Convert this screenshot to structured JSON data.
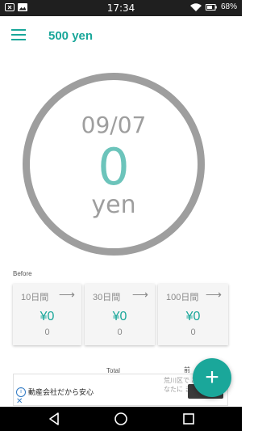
{
  "status_bar": {
    "time": "17:34",
    "battery": "68%"
  },
  "app_bar": {
    "title": "500 yen"
  },
  "main": {
    "date": "09/07",
    "amount": "0",
    "unit": "yen"
  },
  "before": {
    "label": "Before",
    "cards": [
      {
        "period": "10日間",
        "amount": "¥0",
        "count": "0"
      },
      {
        "period": "30日間",
        "amount": "¥0",
        "count": "0"
      },
      {
        "period": "100日間",
        "amount": "¥0",
        "count": "0"
      }
    ]
  },
  "total_label": "Total",
  "partial_text": "前",
  "ad": {
    "text": "動産会社だから安心",
    "desc": "荒川区で あなたに ます"
  },
  "colors": {
    "accent": "#1aa79a",
    "amount": "#6cc4bb",
    "ring": "#9e9e9e"
  }
}
